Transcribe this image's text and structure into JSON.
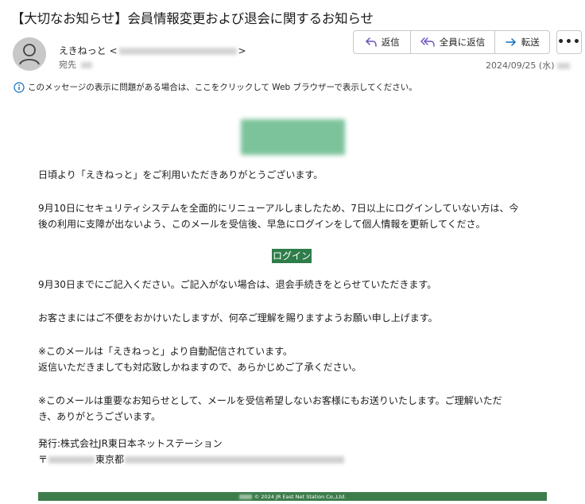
{
  "header": {
    "subject": "【大切なお知らせ】会員情報変更および退会に関するお知らせ",
    "sender_name": "えきねっと",
    "addr_open": "<",
    "addr_close": ">",
    "to_label": "宛先",
    "date": "2024/09/25 (水)"
  },
  "actions": {
    "reply": "返信",
    "reply_all": "全員に返信",
    "forward": "転送",
    "more": "•••"
  },
  "info_bar": {
    "text": "このメッセージの表示に問題がある場合は、ここをクリックして Web ブラウザーで表示してください。"
  },
  "body": {
    "greeting": "日頃より「えきねっと」をご利用いただきありがとうございます。",
    "para1_line1": "9月10日にセキュリティシステムを全面的にリニューアルしましたため、7日以上にログインしていない方は、今",
    "para1_line2": "後の利用に支障が出ないよう、このメールを受信後、早急にログインをして個人情報を更新してくださ。",
    "login_button": "ログイン",
    "para2": "9月30日までにご記入ください。ご記入がない場合は、退会手続きをとらせていただきます。",
    "para3": "お客さまにはご不便をおかけいたしますが、何卒ご理解を賜りますようお願い申し上げます。",
    "note1_line1": "※このメールは「えきねっと」より自動配信されています。",
    "note1_line2": "返信いただきましても対応致しかねますので、あらかじめご了承ください。",
    "note2_line1": "※このメールは重要なお知らせとして、メールを受信希望しないお客様にもお送りいたします。ご理解いただ",
    "note2_line2": "き、ありがとうございます。",
    "publisher": "発行:株式会社JR東日本ネットステーション",
    "postal_mark": "〒",
    "city": "東京都"
  },
  "footer": {
    "copyright": "© 2024 JR East Net Station Co.,Ltd."
  },
  "colors": {
    "login_green": "#2e7d4a",
    "footer_green": "#3d7d4b",
    "action_icon_purple": "#6b4fbb",
    "info_icon_blue": "#0f6cbd"
  }
}
